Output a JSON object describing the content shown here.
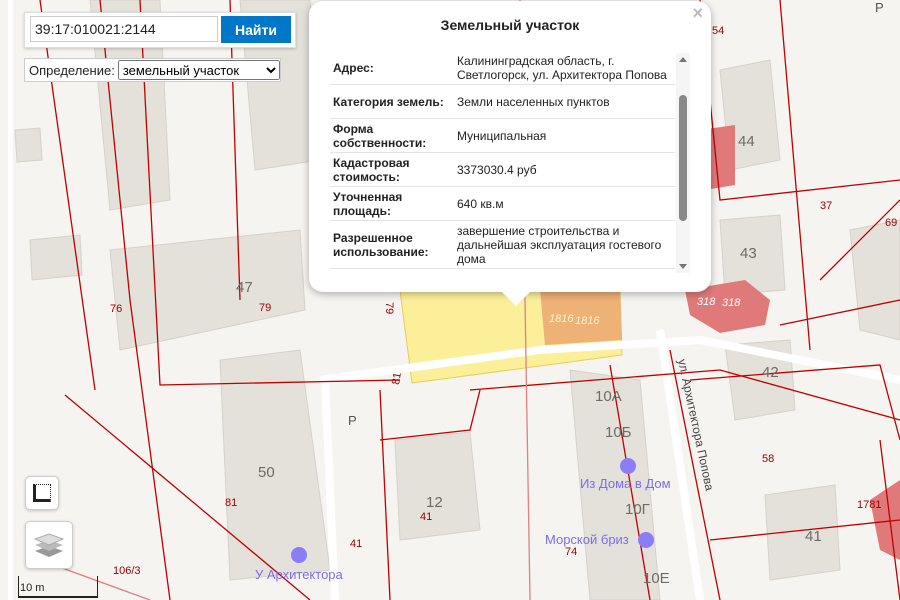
{
  "search": {
    "value": "39:17:010021:2144",
    "button_label": "Найти"
  },
  "definition": {
    "label": "Определение:",
    "selected": "земельный участок"
  },
  "popup": {
    "title": "Земельный участок",
    "close_icon": "×",
    "rows": [
      {
        "key": "Адрес:",
        "value": "Калининградская область, г. Светлогорск, ул. Архитектора Попова"
      },
      {
        "key": "Категория земель:",
        "value": "Земли населенных пунктов"
      },
      {
        "key": "Форма собственности:",
        "value": "Муниципальная"
      },
      {
        "key": "Кадастровая стоимость:",
        "value": "3373030.4 руб"
      },
      {
        "key": "Уточненная площадь:",
        "value": "640 кв.м"
      },
      {
        "key": "Разрешенное использование:",
        "value": "завершение строительства и дальнейшая эксплуатация гостевого дома"
      }
    ],
    "scroll_position": 0.3
  },
  "scale": {
    "label": "10 m"
  },
  "map": {
    "building_numbers": [
      "47",
      "50",
      "12",
      "44",
      "43",
      "42",
      "41",
      "10А",
      "10Б",
      "10Г",
      "10Е"
    ],
    "parcel_labels": [
      "76",
      "79",
      "79",
      "81",
      "81",
      "41",
      "41",
      "106/3",
      "54",
      "37",
      "58",
      "1781",
      "74",
      "69",
      "318",
      "318",
      "1816",
      "1816"
    ],
    "pois": [
      "Из Дома в Дом",
      "Морской бриз",
      "У Архитектора"
    ],
    "street": "ул. Архитектора Попова",
    "parking": "P"
  }
}
